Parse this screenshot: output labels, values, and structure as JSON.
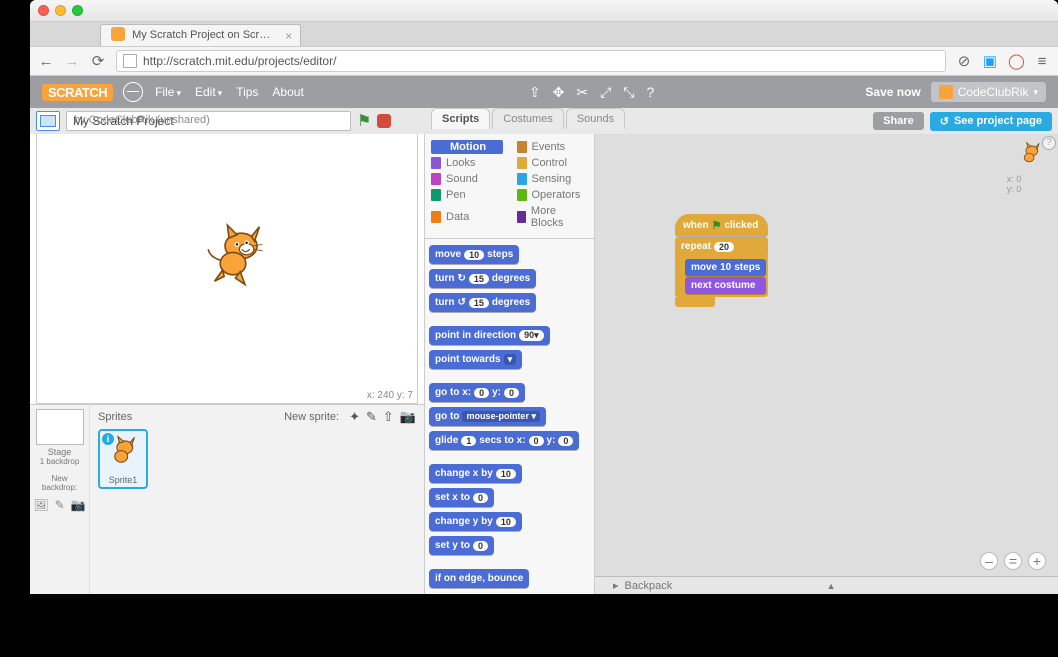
{
  "browser": {
    "tab_title": "My Scratch Project on Scr…",
    "url": "http://scratch.mit.edu/projects/editor/"
  },
  "scratch_menu": {
    "logo": "SCRATCH",
    "file": "File",
    "edit": "Edit",
    "tips": "Tips",
    "about": "About",
    "save_now": "Save now",
    "username": "CodeClubRik"
  },
  "project": {
    "title": "My Scratch Project",
    "byline": "by CodeClubRik (unshared)",
    "share": "Share",
    "see_page": "See project page"
  },
  "stage": {
    "coords": "x: 240   y: 7"
  },
  "sprites": {
    "label": "Sprites",
    "new_sprite": "New sprite:",
    "stage_label": "Stage",
    "backdrop_count": "1 backdrop",
    "new_backdrop": "New backdrop:",
    "sprite1": "Sprite1"
  },
  "editor_tabs": {
    "scripts": "Scripts",
    "costumes": "Costumes",
    "sounds": "Sounds"
  },
  "categories": {
    "motion": "Motion",
    "looks": "Looks",
    "sound": "Sound",
    "pen": "Pen",
    "data": "Data",
    "events": "Events",
    "control": "Control",
    "sensing": "Sensing",
    "operators": "Operators",
    "more": "More Blocks"
  },
  "blocks": {
    "move": "move",
    "steps": "steps",
    "val10": "10",
    "turn": "turn",
    "degrees": "degrees",
    "val15": "15",
    "point_dir": "point in direction",
    "val90": "90",
    "point_tow": "point towards",
    "goto_xy": "go to x:",
    "y": "y:",
    "val0": "0",
    "goto_mp": "go to",
    "mp": "mouse-pointer",
    "glide": "glide",
    "secs": "secs to x:",
    "val1": "1",
    "change_x": "change x by",
    "set_x": "set x to",
    "change_y": "change y by",
    "set_y": "set y to",
    "edge": "if on edge, bounce"
  },
  "script": {
    "when": "when",
    "clicked": "clicked",
    "repeat": "repeat",
    "val20": "20",
    "next_costume": "next costume"
  },
  "mini": {
    "x": "x: 0",
    "y": "y: 0"
  },
  "backpack": "Backpack"
}
